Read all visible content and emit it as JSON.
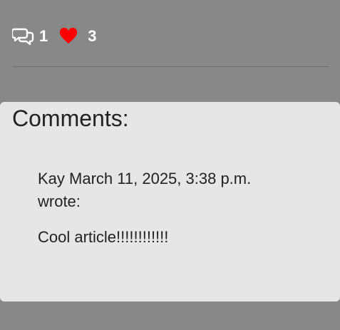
{
  "stats": {
    "comment_count": "1",
    "like_count": "3",
    "comment_icon": "speech-bubbles-icon",
    "like_icon": "heart-icon",
    "like_color": "#ff0000"
  },
  "comments_section": {
    "heading": "Comments:",
    "comments": [
      {
        "author": "Kay",
        "date": "March 11, 2025, 3:38 p.m.",
        "verb": "wrote:",
        "body": "Cool article!!!!!!!!!!!!"
      }
    ]
  }
}
